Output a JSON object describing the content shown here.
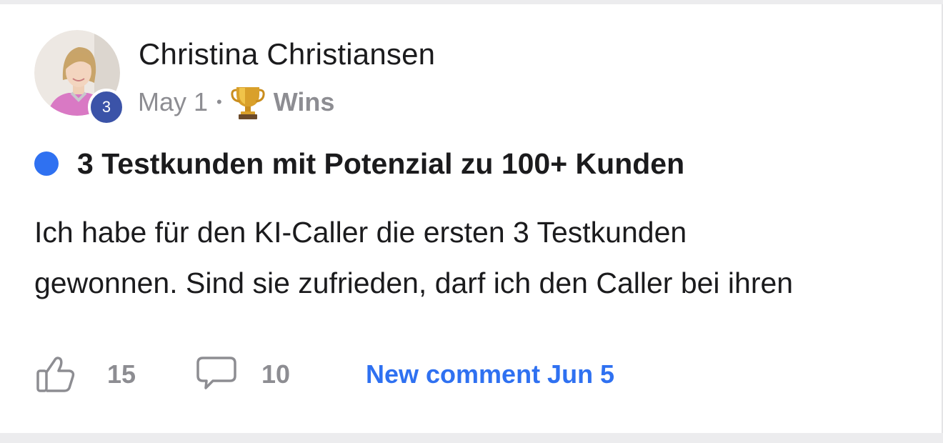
{
  "post": {
    "author": "Christina Christiansen",
    "level": "3",
    "date": "May 1",
    "separator": "•",
    "category": "Wins",
    "category_icon": "trophy-icon",
    "unread": true,
    "unread_color": "#2f71f1",
    "title": "3 Testkunden mit Potenzial zu 100+ Kunden",
    "body_line1": "Ich habe für den KI-Caller die ersten 3 Testkunden",
    "body_line2": "gewonnen. Sind sie zufrieden, darf ich den Caller bei ihren"
  },
  "actions": {
    "likes": "15",
    "comments": "10",
    "new_comment": "New comment Jun 5",
    "like_icon": "thumbs-up-icon",
    "comment_icon": "comment-bubble-icon"
  },
  "colors": {
    "accent": "#2f71f1",
    "badge": "#3b53a8",
    "muted_text": "#8d8d92",
    "text": "#1b1b1d"
  }
}
